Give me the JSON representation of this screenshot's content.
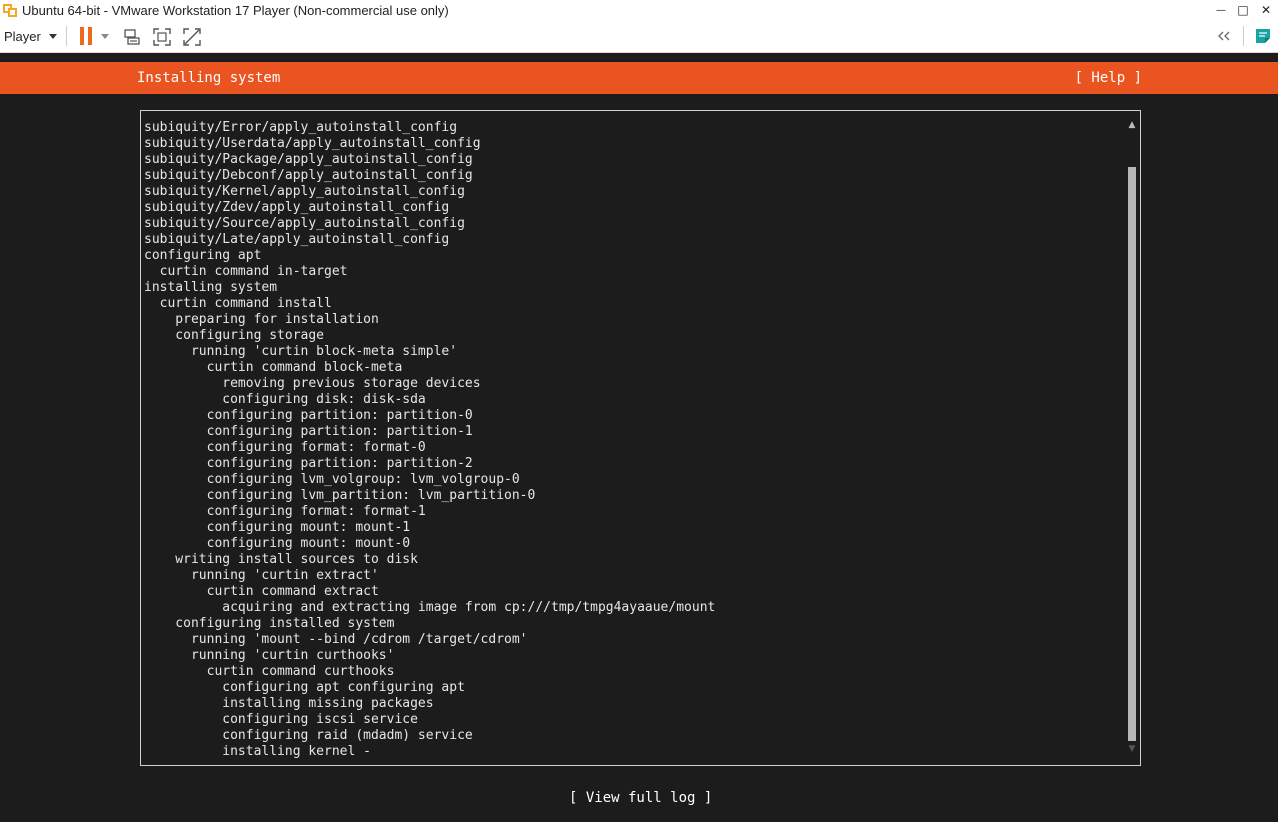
{
  "window": {
    "title": "Ubuntu 64-bit - VMware Workstation 17 Player (Non-commercial use only)",
    "minimize_glyph": "—",
    "maximize_glyph": "□",
    "close_glyph": "✕"
  },
  "toolbar": {
    "player_label": "Player",
    "icons": [
      "pause-icon",
      "send-ctrl-alt-del-icon",
      "full-screen-icon",
      "unity-icon",
      "collapse-icon",
      "notes-icon"
    ],
    "accent_color": "#ee6a1f"
  },
  "installer": {
    "header_title": "Installing system",
    "help_label": "[ Help ]",
    "header_color": "#e95420",
    "log_lines": [
      "subiquity/Error/apply_autoinstall_config",
      "subiquity/Userdata/apply_autoinstall_config",
      "subiquity/Package/apply_autoinstall_config",
      "subiquity/Debconf/apply_autoinstall_config",
      "subiquity/Kernel/apply_autoinstall_config",
      "subiquity/Zdev/apply_autoinstall_config",
      "subiquity/Source/apply_autoinstall_config",
      "subiquity/Late/apply_autoinstall_config",
      "configuring apt",
      "  curtin command in-target",
      "installing system",
      "  curtin command install",
      "    preparing for installation",
      "    configuring storage",
      "      running 'curtin block-meta simple'",
      "        curtin command block-meta",
      "          removing previous storage devices",
      "          configuring disk: disk-sda",
      "        configuring partition: partition-0",
      "        configuring partition: partition-1",
      "        configuring format: format-0",
      "        configuring partition: partition-2",
      "        configuring lvm_volgroup: lvm_volgroup-0",
      "        configuring lvm_partition: lvm_partition-0",
      "        configuring format: format-1",
      "        configuring mount: mount-1",
      "        configuring mount: mount-0",
      "    writing install sources to disk",
      "      running 'curtin extract'",
      "        curtin command extract",
      "          acquiring and extracting image from cp:///tmp/tmpg4ayaaue/mount",
      "    configuring installed system",
      "      running 'mount --bind /cdrom /target/cdrom'",
      "      running 'curtin curthooks'",
      "        curtin command curthooks",
      "          configuring apt configuring apt",
      "          installing missing packages",
      "          configuring iscsi service",
      "          configuring raid (mdadm) service",
      "          installing kernel -"
    ],
    "scroll_up_glyph": "▲",
    "scroll_down_glyph": "▼",
    "view_full_log_label": "[ View full log ]"
  }
}
